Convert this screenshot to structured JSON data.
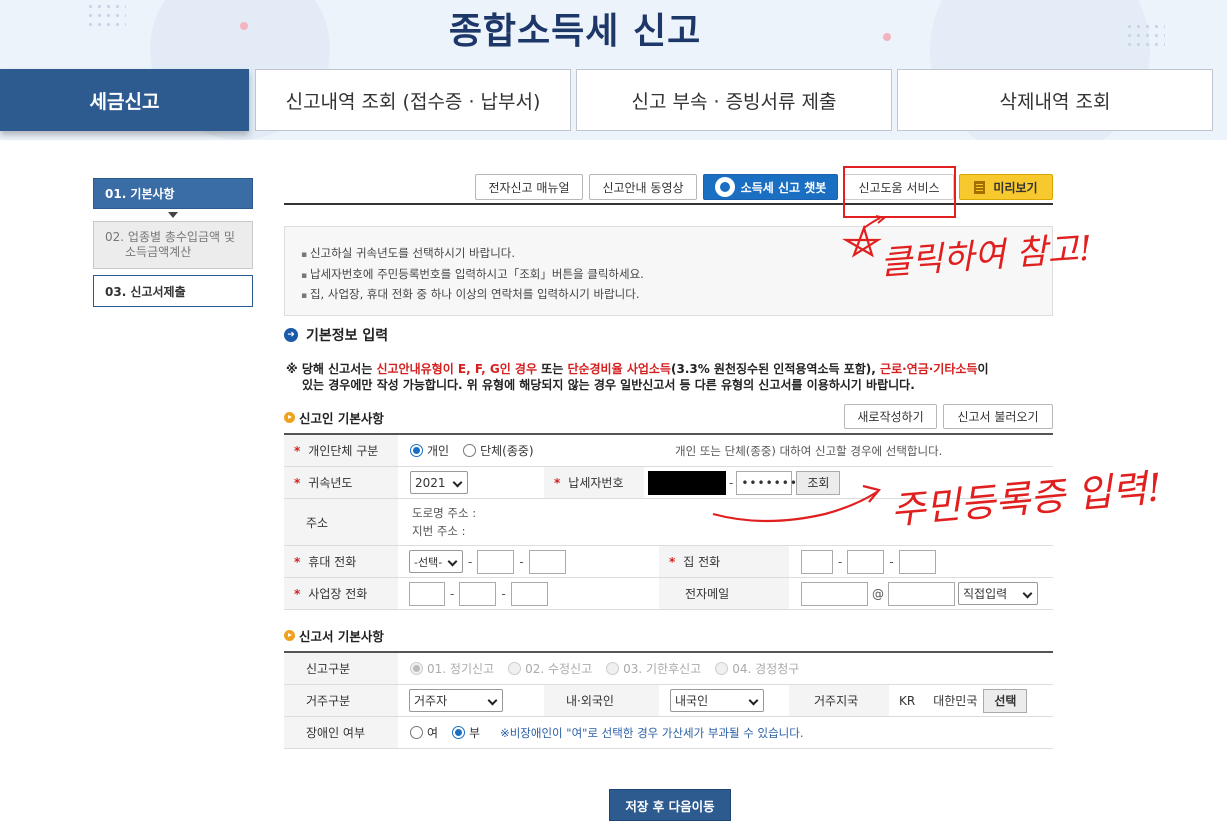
{
  "header": {
    "title": "종합소득세 신고",
    "tabs": [
      {
        "label": "세금신고",
        "active": true
      },
      {
        "label": "신고내역 조회 (접수증 · 납부서)"
      },
      {
        "label": "신고 부속 · 증빙서류 제출"
      },
      {
        "label": "삭제내역 조회"
      }
    ]
  },
  "steps": [
    {
      "label": "01. 기본사항",
      "state": "current"
    },
    {
      "label_line1": "02. 업종별 총수입금액 및",
      "label_line2": "소득금액계산",
      "state": "disabled"
    },
    {
      "label": "03. 신고서제출",
      "state": "normal"
    }
  ],
  "toolbar": {
    "manual": "전자신고 매뉴얼",
    "video": "신고안내 동영상",
    "chatbot": "소득세 신고 챗봇",
    "help_service": "신고도움 서비스",
    "preview": "미리보기"
  },
  "notice": [
    "신고하실 귀속년도를 선택하시기 바랍니다.",
    "납세자번호에 주민등록번호를 입력하시고「조회」버튼을 클릭하세요.",
    "집, 사업장, 휴대 전화 중 하나 이상의 연락처를 입력하시기 바랍니다."
  ],
  "basic_info_title": "기본정보 입력",
  "warning": {
    "p1": "※ 당해 신고서는 ",
    "r1": "신고안내유형이 E, F, G인 경우",
    "p2": " 또는 ",
    "r2": "단순경비율 사업소득",
    "p3": "(3.3% 원천징수된 인적용역소득 포함), ",
    "r3": "근로·연금·기타소득",
    "p4": "이",
    "line2": "있는 경우에만 작성 가능합니다. 위 유형에 해당되지 않는 경우 일반신고서 등 다른 유형의 신고서를 이용하시기 바랍니다."
  },
  "filer_section": {
    "title": "신고인 기본사항",
    "new_button": "새로작성하기",
    "load_button": "신고서 불러오기",
    "type_label": "개인단체 구분",
    "type_options": [
      "개인",
      "단체(종중)"
    ],
    "type_selected": "개인",
    "type_hint": "개인 또는 단체(종중) 대하여 신고할 경우에 선택합니다.",
    "year_label": "귀속년도",
    "year_value": "2021",
    "taxpayer_label": "납세자번호",
    "taxpayer_masked": "•••••••",
    "lookup_button": "조회",
    "address_label": "주소",
    "road_address": "도로명 주소 :",
    "lot_address": "지번 주소 :",
    "mobile_label": "휴대 전화",
    "mobile_select": "-선택-",
    "home_label": "집 전화",
    "business_label": "사업장 전화",
    "email_label": "전자메일",
    "email_at": "@",
    "email_domain_select": "직접입력"
  },
  "report_section": {
    "title": "신고서 기본사항",
    "kind_label": "신고구분",
    "kind_options": [
      "01. 정기신고",
      "02. 수정신고",
      "03. 기한후신고",
      "04. 경정청구"
    ],
    "residence_label": "거주구분",
    "residence_value": "거주자",
    "nationality_label": "내·외국인",
    "nationality_value": "내국인",
    "country_label": "거주지국",
    "country_code": "KR",
    "country_name": "대한민국",
    "country_button": "선택",
    "disability_label": "장애인 여부",
    "disability_options": [
      "여",
      "부"
    ],
    "disability_selected": "부",
    "disability_note": "※비장애인이 \"여\"로 선택한 경우 가산세가 부과될 수 있습니다."
  },
  "save_button": "저장 후 다음이동",
  "annotations": {
    "click_note": "클릭하여 참고!",
    "id_note": "주민등록증 입력!"
  },
  "colors": {
    "brand_navy": "#2d5a8f",
    "title_navy": "#1c3768",
    "chatbot_blue": "#1a6fc2",
    "preview_yellow": "#f7c92e",
    "warning_red": "#d52020",
    "annotation_red": "#e01f1f"
  }
}
